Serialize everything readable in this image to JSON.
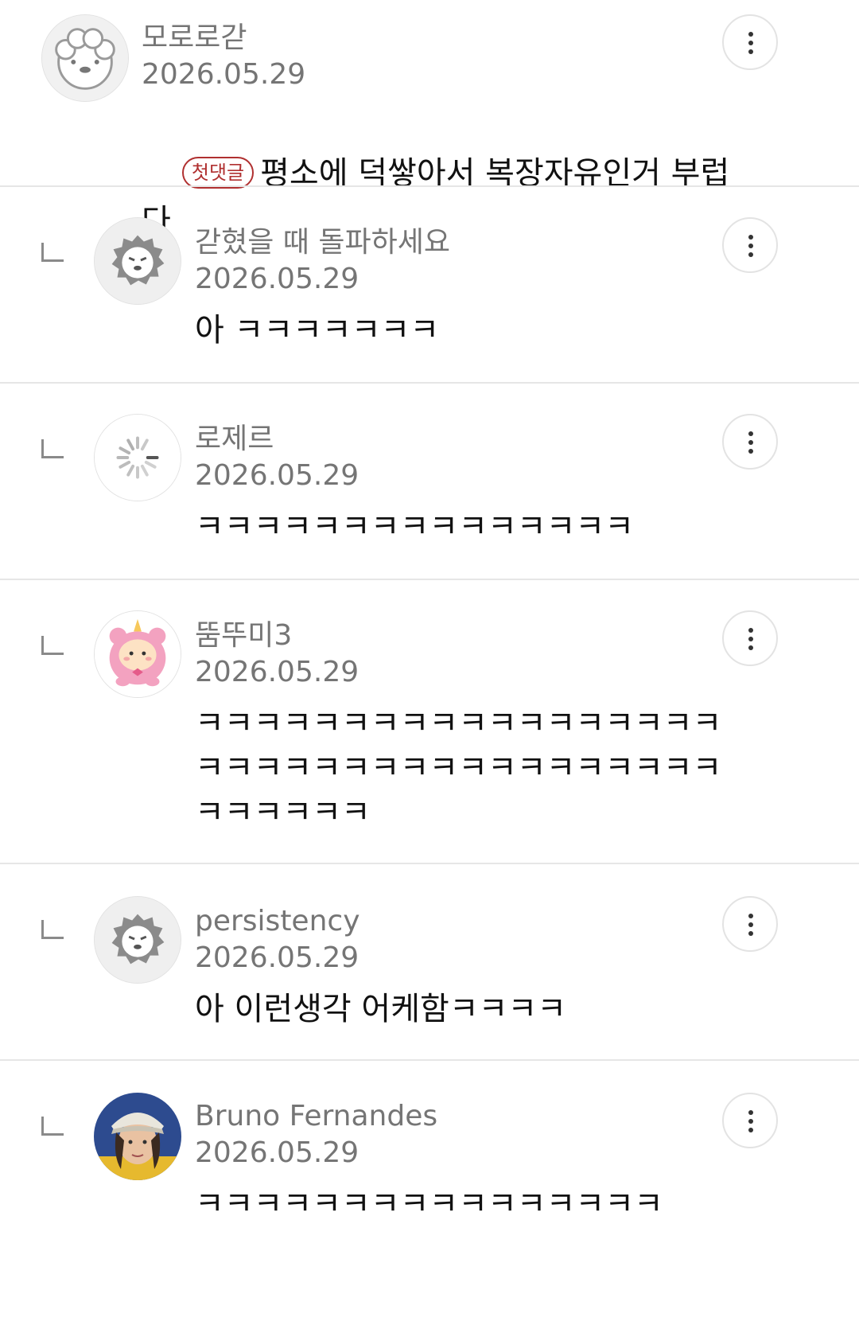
{
  "comments": [
    {
      "author": "모로로갇",
      "date": "2026.05.29",
      "badge": "첫댓글",
      "body": "평소에 덕쌓아서 복장자유인거 부럽다",
      "avatar_icon": "poodle-avatar-icon",
      "more_icon": "more-vertical-icon"
    },
    {
      "author": "갇혔을 때 돌파하세요",
      "date": "2026.05.29",
      "body": "아 ㅋㅋㅋㅋㅋㅋㅋ",
      "avatar_icon": "lion-avatar-icon",
      "more_icon": "more-vertical-icon"
    },
    {
      "author": "로제르",
      "date": "2026.05.29",
      "body": "ㅋㅋㅋㅋㅋㅋㅋㅋㅋㅋㅋㅋㅋㅋㅋ",
      "avatar_icon": "loading-spinner-icon",
      "more_icon": "more-vertical-icon"
    },
    {
      "author": "뚬뚜미3",
      "date": "2026.05.29",
      "body": "ㅋㅋㅋㅋㅋㅋㅋㅋㅋㅋㅋㅋㅋㅋㅋㅋㅋㅋㅋㅋㅋㅋㅋㅋㅋㅋㅋㅋㅋㅋㅋㅋㅋㅋㅋㅋㅋㅋㅋㅋㅋㅋ",
      "avatar_icon": "pink-bear-avatar-icon",
      "more_icon": "more-vertical-icon"
    },
    {
      "author": "persistency",
      "date": "2026.05.29",
      "body": "아 이런생각 어케함ㅋㅋㅋㅋ",
      "avatar_icon": "lion-avatar-icon",
      "more_icon": "more-vertical-icon"
    },
    {
      "author": "Bruno Fernandes",
      "date": "2026.05.29",
      "body": "ㅋㅋㅋㅋㅋㅋㅋㅋㅋㅋㅋㅋㅋㅋㅋㅋ",
      "avatar_icon": "user-photo-avatar",
      "more_icon": "more-vertical-icon"
    }
  ],
  "colors": {
    "meta_text": "#757575",
    "body_text": "#111111",
    "divider": "#e6e6e6",
    "badge": "#b03030"
  }
}
